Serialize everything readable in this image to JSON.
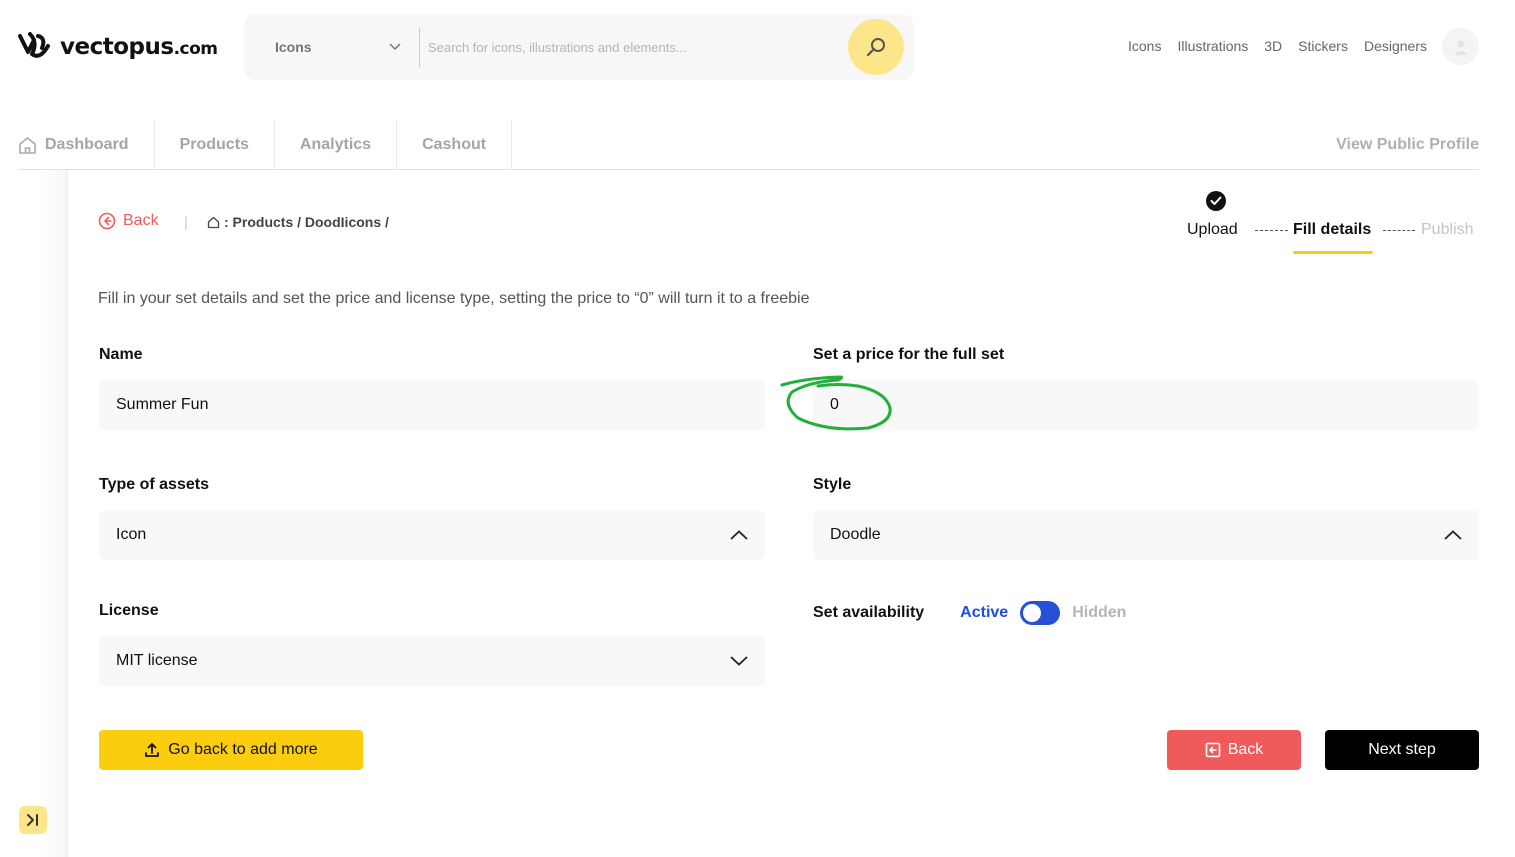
{
  "header": {
    "logo_text": "vectopus",
    "logo_suffix": ".com",
    "search_type": "Icons",
    "search_placeholder": "Search for icons, illustrations and elements...",
    "nav": [
      "Icons",
      "Illustrations",
      "3D",
      "Stickers",
      "Designers"
    ]
  },
  "tabs": {
    "items": [
      "Dashboard",
      "Products",
      "Analytics",
      "Cashout"
    ],
    "public_profile": "View Public Profile"
  },
  "breadcrumb": {
    "back": "Back",
    "separator": "|",
    "path": ": Products / DoodIicons /"
  },
  "stepper": {
    "upload": "Upload",
    "fill": "Fill details",
    "publish": "Publish",
    "current": "Fill details"
  },
  "intro": "Fill in your set details and set the price and license type, setting the price to “0” will turn it to a freebie",
  "form": {
    "name_label": "Name",
    "name_value": "Summer Fun",
    "price_label": "Set a price for the full set",
    "price_value": "0",
    "type_label": "Type of assets",
    "type_value": "Icon",
    "style_label": "Style",
    "style_value": "Doodle",
    "license_label": "License",
    "license_value": "MIT license",
    "availability_label": "Set availability",
    "availability_active": "Active",
    "availability_hidden": "Hidden",
    "availability_on": true
  },
  "buttons": {
    "go_back_more": "Go back to add more",
    "back": "Back",
    "next": "Next step"
  },
  "colors": {
    "accent_yellow": "#fccc0f",
    "danger_red": "#ef5b5b",
    "toggle_blue": "#2451d6",
    "annotation_green": "#22b03a"
  }
}
